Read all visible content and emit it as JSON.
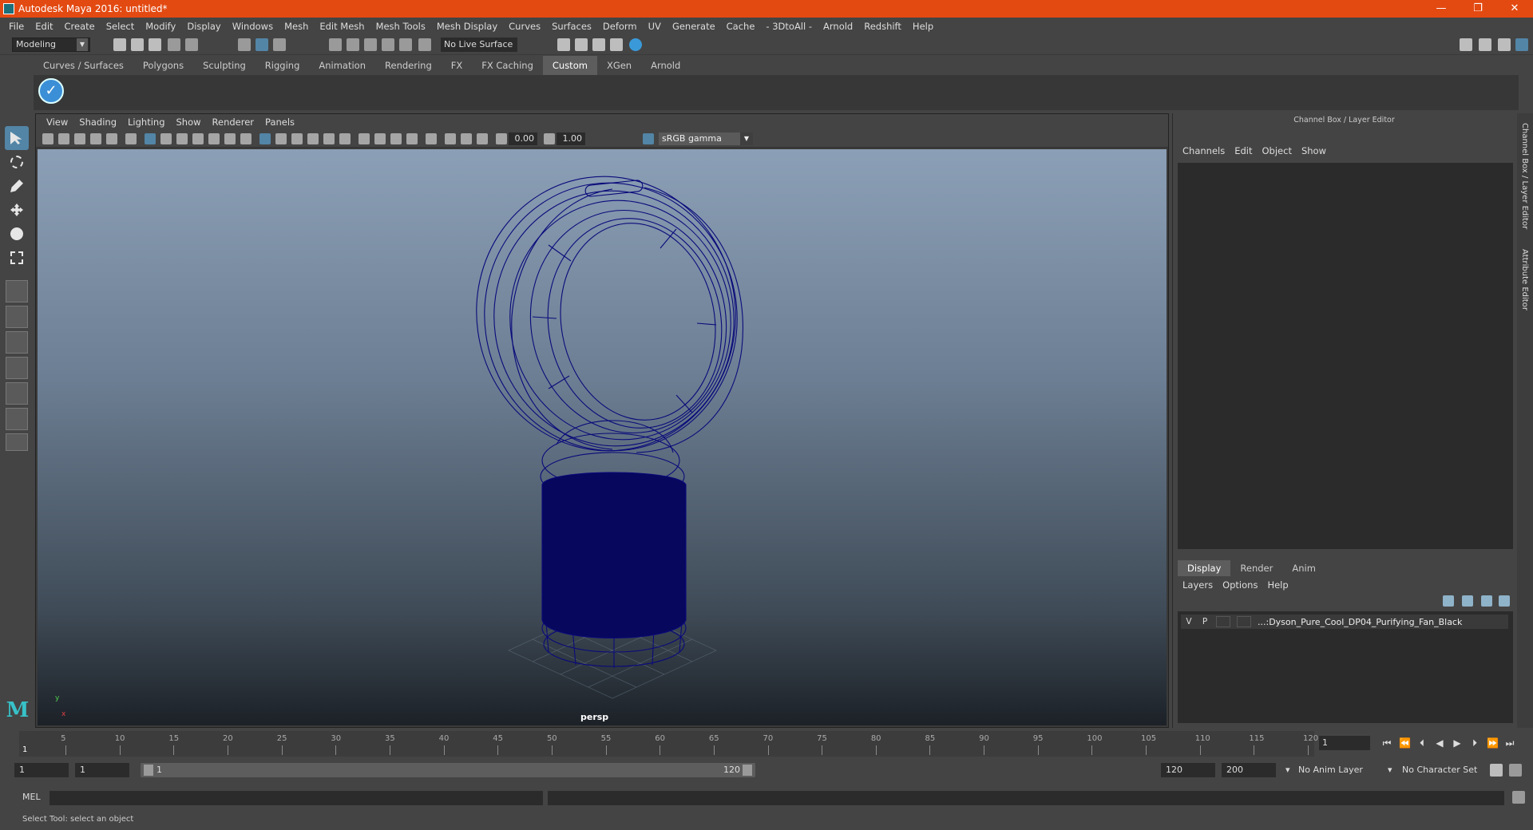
{
  "window": {
    "title": "Autodesk Maya 2016: untitled*",
    "minimize": "—",
    "restore": "❐",
    "close": "✕"
  },
  "menubar": [
    "File",
    "Edit",
    "Create",
    "Select",
    "Modify",
    "Display",
    "Windows",
    "Mesh",
    "Edit Mesh",
    "Mesh Tools",
    "Mesh Display",
    "Curves",
    "Surfaces",
    "Deform",
    "UV",
    "Generate",
    "Cache",
    "- 3DtoAll -",
    "Arnold",
    "Redshift",
    "Help"
  ],
  "statusline": {
    "mode": "Modeling",
    "live_surface": "No Live Surface"
  },
  "shelf": {
    "tabs": [
      "Curves / Surfaces",
      "Polygons",
      "Sculpting",
      "Rigging",
      "Animation",
      "Rendering",
      "FX",
      "FX Caching",
      "Custom",
      "XGen",
      "Arnold"
    ],
    "active_tab": "Custom",
    "button_icon": "checkmark-icon"
  },
  "viewport": {
    "menu": [
      "View",
      "Shading",
      "Lighting",
      "Show",
      "Renderer",
      "Panels"
    ],
    "exposure": "0.00",
    "gamma": "1.00",
    "color_space": "sRGB gamma",
    "camera": "persp",
    "axis_x": "x",
    "axis_y": "y",
    "wire_color": "#0a0a7a",
    "mesh_fill": "#07075e"
  },
  "channel_box": {
    "title": "Channel Box / Layer Editor",
    "menu": [
      "Channels",
      "Edit",
      "Object",
      "Show"
    ],
    "layer_tabs": [
      "Display",
      "Render",
      "Anim"
    ],
    "active_layer_tab": "Display",
    "layer_menu": [
      "Layers",
      "Options",
      "Help"
    ],
    "layer": {
      "v": "V",
      "p": "P",
      "name": "...:Dyson_Pure_Cool_DP04_Purifying_Fan_Black"
    }
  },
  "side_tabs": [
    "Channel Box / Layer Editor",
    "Attribute Editor"
  ],
  "timeslider": {
    "ticks": [
      "5",
      "10",
      "15",
      "20",
      "25",
      "30",
      "35",
      "40",
      "45",
      "50",
      "55",
      "60",
      "65",
      "70",
      "75",
      "80",
      "85",
      "90",
      "95",
      "100",
      "105",
      "110",
      "115",
      "120"
    ],
    "current_marker": "1",
    "current_frame": "1"
  },
  "range": {
    "start": "1",
    "playback_start": "1",
    "slider_start": "1",
    "slider_end": "120",
    "playback_end": "120",
    "end": "200",
    "anim_layer": "No Anim Layer",
    "character_set": "No Character Set"
  },
  "cmdline": {
    "label": "MEL"
  },
  "status": {
    "help": "Select Tool: select an object"
  }
}
